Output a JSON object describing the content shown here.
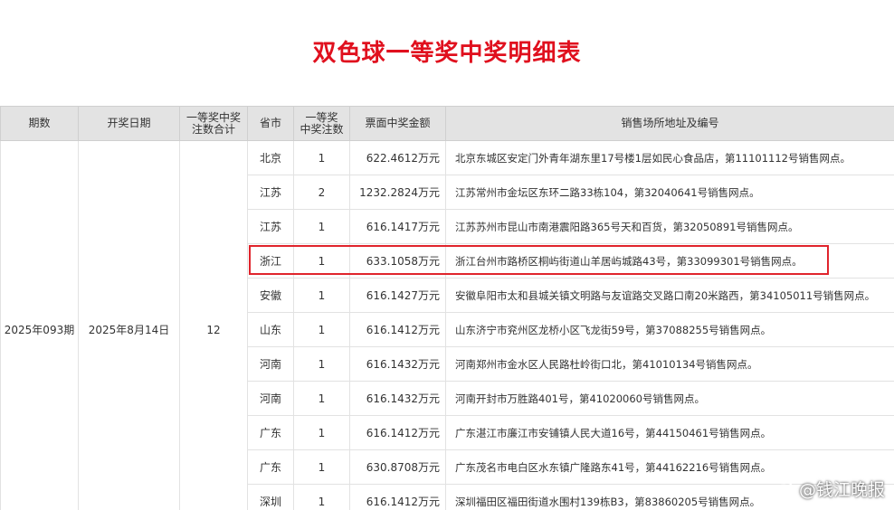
{
  "title": "双色球一等奖中奖明细表",
  "table": {
    "headers": [
      "期数",
      "开奖日期",
      "一等奖中奖\n注数合计",
      "省市",
      "一等奖\n中奖注数",
      "票面中奖金额",
      "销售场所地址及编号"
    ],
    "period": "2025年093期",
    "draw_date": "2025年8月14日",
    "total_winners": "12",
    "rows": [
      {
        "province": "北京",
        "count": "1",
        "amount": "622.4612万元",
        "address": "北京东城区安定门外青年湖东里17号楼1层如民心食品店，第11101112号销售网点。"
      },
      {
        "province": "江苏",
        "count": "2",
        "amount": "1232.2824万元",
        "address": "江苏常州市金坛区东环二路33栋104，第32040641号销售网点。"
      },
      {
        "province": "江苏",
        "count": "1",
        "amount": "616.1417万元",
        "address": "江苏苏州市昆山市南港震阳路365号天和百货，第32050891号销售网点。"
      },
      {
        "province": "浙江",
        "count": "1",
        "amount": "633.1058万元",
        "address": "浙江台州市路桥区桐屿街道山羊居屿城路43号，第33099301号销售网点。"
      },
      {
        "province": "安徽",
        "count": "1",
        "amount": "616.1427万元",
        "address": "安徽阜阳市太和县城关镇文明路与友谊路交叉路口南20米路西，第34105011号销售网点。"
      },
      {
        "province": "山东",
        "count": "1",
        "amount": "616.1412万元",
        "address": "山东济宁市兖州区龙桥小区飞龙街59号，第37088255号销售网点。"
      },
      {
        "province": "河南",
        "count": "1",
        "amount": "616.1432万元",
        "address": "河南郑州市金水区人民路杜岭街口北，第41010134号销售网点。"
      },
      {
        "province": "河南",
        "count": "1",
        "amount": "616.1432万元",
        "address": "河南开封市万胜路401号，第41020060号销售网点。"
      },
      {
        "province": "广东",
        "count": "1",
        "amount": "616.1412万元",
        "address": "广东湛江市廉江市安铺镇人民大道16号，第44150461号销售网点。"
      },
      {
        "province": "广东",
        "count": "1",
        "amount": "630.8708万元",
        "address": "广东茂名市电白区水东镇广隆路东41号，第44162216号销售网点。"
      },
      {
        "province": "深圳",
        "count": "1",
        "amount": "616.1412万元",
        "address": "深圳福田区福田街道水围村139栋B3，第83860205号销售网点。"
      }
    ]
  },
  "highlight_color": "#e0242c",
  "title_color": "#e0101e",
  "watermark": {
    "icon": "weibo-icon",
    "text": "@钱江晚报"
  }
}
